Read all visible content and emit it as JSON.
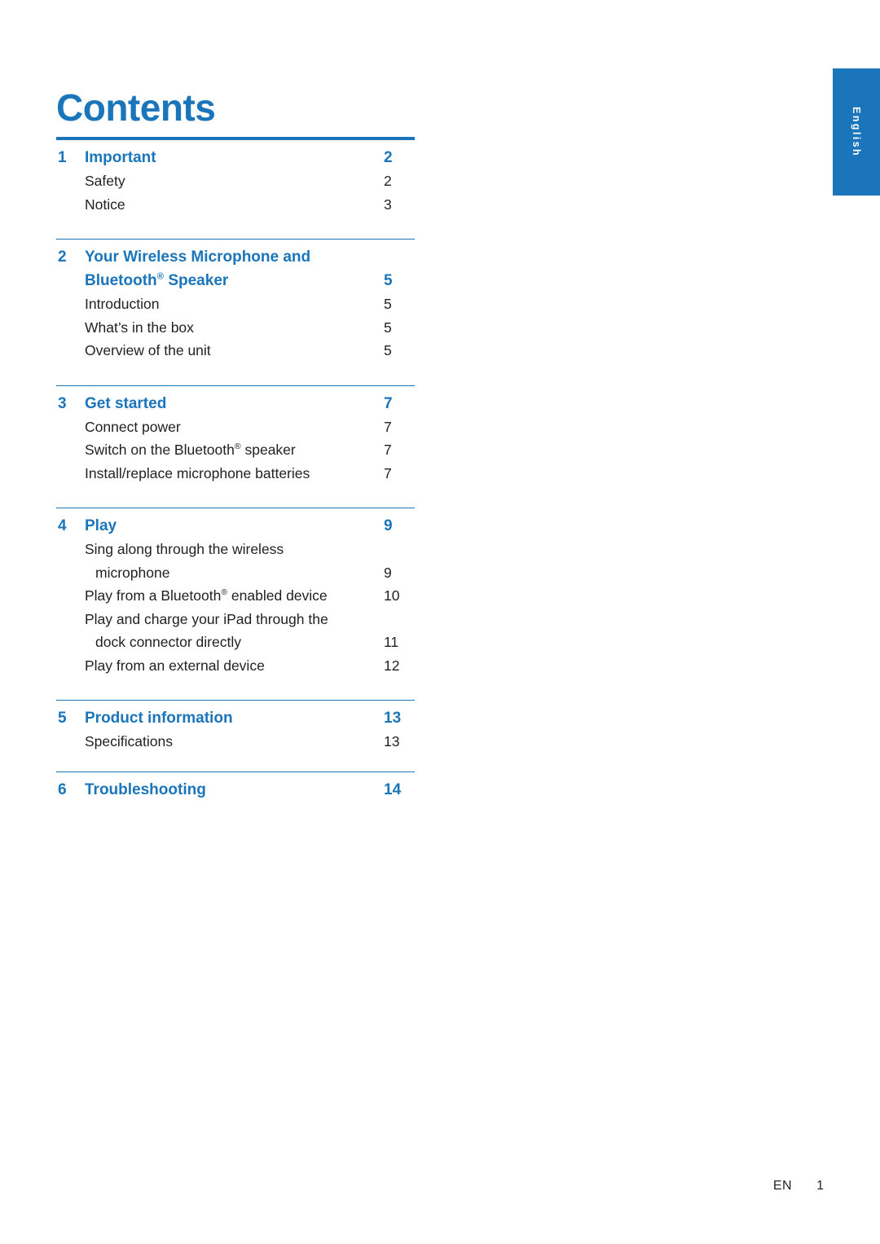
{
  "page_title": "Contents",
  "side_tab": {
    "label": "English",
    "color": "#1b75bb"
  },
  "footer": {
    "lang": "EN",
    "page": "1"
  },
  "toc": {
    "chapters": [
      {
        "num": "1",
        "label": "Important",
        "page": "2",
        "subs": [
          {
            "label": "Safety",
            "page": "2"
          },
          {
            "label": "Notice",
            "page": "3"
          }
        ]
      },
      {
        "num": "2",
        "label": "Your Wireless Microphone and",
        "label2": "Bluetooth® Speaker",
        "page": "5",
        "subs": [
          {
            "label": "Introduction",
            "page": "5"
          },
          {
            "label": "What’s in the box",
            "page": "5"
          },
          {
            "label": "Overview of the unit",
            "page": "5"
          }
        ]
      },
      {
        "num": "3",
        "label": "Get started",
        "page": "7",
        "subs": [
          {
            "label": "Connect power",
            "page": "7"
          },
          {
            "label": "Switch on the Bluetooth® speaker",
            "page": "7"
          },
          {
            "label": "Install/replace microphone batteries",
            "page": "7"
          }
        ]
      },
      {
        "num": "4",
        "label": "Play",
        "page": "9",
        "subs": [
          {
            "label": "Sing along through the wireless",
            "page": ""
          },
          {
            "label": "microphone",
            "page": "9",
            "indent": true
          },
          {
            "label": "Play from a Bluetooth® enabled device",
            "page": "10"
          },
          {
            "label": "Play and charge your iPad through the",
            "page": ""
          },
          {
            "label": "dock connector directly",
            "page": "11",
            "indent": true
          },
          {
            "label": "Play from an external device",
            "page": "12"
          }
        ]
      },
      {
        "num": "5",
        "label": "Product information",
        "page": "13",
        "subs": [
          {
            "label": "Specifications",
            "page": "13"
          }
        ]
      },
      {
        "num": "6",
        "label": "Troubleshooting",
        "page": "14",
        "subs": []
      }
    ]
  }
}
